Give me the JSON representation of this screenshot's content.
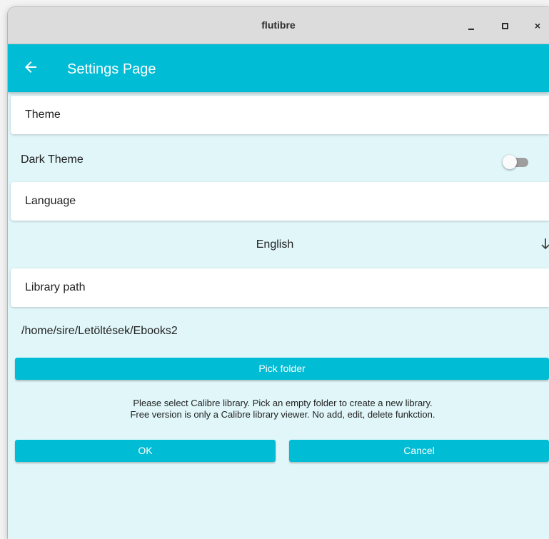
{
  "window": {
    "title": "flutibre",
    "min_glyph": "_",
    "close_glyph": "×"
  },
  "appbar": {
    "title": "Settings Page",
    "back_icon": "arrow-left-icon"
  },
  "theme_section": {
    "header": "Theme",
    "dark_theme_label": "Dark Theme",
    "dark_theme_enabled": false
  },
  "language_section": {
    "header": "Language",
    "selected": "English",
    "dropdown_icon": "arrow-down-icon"
  },
  "library_section": {
    "header": "Library path",
    "path": "/home/sire/Letöltések/Ebooks2",
    "pick_button": "Pick folder",
    "info_line1": "Please select Calibre library. Pick an empty folder to create a new library.",
    "info_line2": "Free version is only a Calibre library viewer. No add, edit, delete funkction."
  },
  "actions": {
    "ok": "OK",
    "cancel": "Cancel"
  },
  "colors": {
    "accent": "#00bcd4",
    "background": "#e0f6f9"
  }
}
